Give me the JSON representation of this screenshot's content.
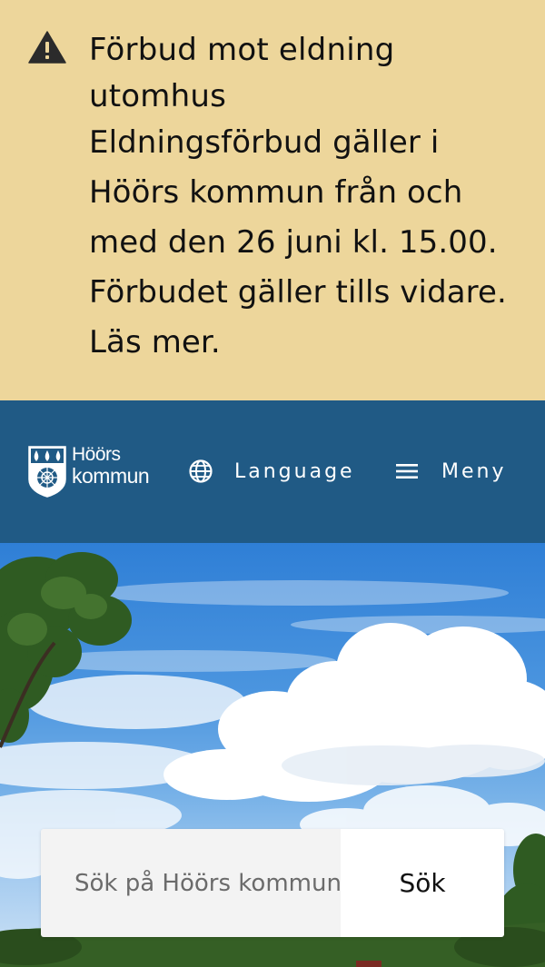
{
  "alert": {
    "icon": "warning-icon",
    "title": "Förbud mot eldning utomhus",
    "body": "Eldningsförbud gäller i Höörs kommun från och med den 26 juni kl. 15.00. Förbudet gäller tills vidare.",
    "link_text": "Läs mer.",
    "colors": {
      "background": "#edd69b",
      "text": "#111111"
    }
  },
  "header": {
    "logo": {
      "line1": "Höörs",
      "line2": "kommun",
      "icon": "municipality-shield-icon"
    },
    "language": {
      "label": "Language",
      "icon": "globe-icon"
    },
    "menu": {
      "label": "Meny",
      "icon": "hamburger-icon"
    },
    "colors": {
      "background": "#205a85",
      "text": "#ffffff"
    }
  },
  "hero": {
    "image": "summer-sky-with-clouds-and-trees"
  },
  "search": {
    "placeholder": "Sök på Höörs kommun",
    "button_label": "Sök"
  }
}
